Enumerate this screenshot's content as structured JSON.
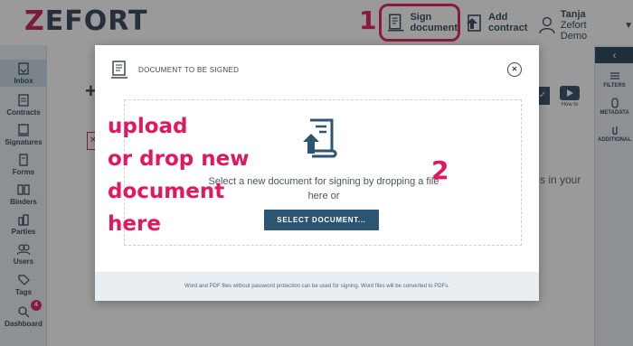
{
  "header": {
    "logo_z": "Z",
    "logo_rest": "EFORT",
    "sign_document_line1": "Sign",
    "sign_document_line2": "document",
    "add_contract_line1": "Add",
    "add_contract_line2": "contract",
    "user_name": "Tanja",
    "user_org": "Zefort Demo"
  },
  "annotations": {
    "step1": "1",
    "step2": "2",
    "upload_line1": "upload",
    "upload_line2": "or drop new",
    "upload_line3": "document",
    "upload_line4": "here"
  },
  "sidebar": {
    "items": [
      {
        "label": "Inbox",
        "icon": "inbox-icon"
      },
      {
        "label": "Contracts",
        "icon": "contracts-icon"
      },
      {
        "label": "Signatures",
        "icon": "signatures-icon"
      },
      {
        "label": "Forms",
        "icon": "forms-icon"
      },
      {
        "label": "Binders",
        "icon": "binders-icon"
      },
      {
        "label": "Parties",
        "icon": "parties-icon"
      },
      {
        "label": "Users",
        "icon": "users-icon"
      },
      {
        "label": "Tags",
        "icon": "tags-icon"
      },
      {
        "label": "Dashboard",
        "icon": "dashboard-icon"
      }
    ],
    "dashboard_badge": "4"
  },
  "right_sidebar": {
    "collapse": "‹",
    "items": [
      {
        "label": "FILTERS"
      },
      {
        "label": "METADATA"
      },
      {
        "label": "ADDITIONAL"
      }
    ]
  },
  "main": {
    "plus": "+",
    "x_mark": "✕",
    "check": "✓",
    "how_to": "How to",
    "partial_text": "s in your"
  },
  "modal": {
    "title": "DOCUMENT TO BE SIGNED",
    "close": "✕",
    "drop_text": "Select a new document for signing by dropping a file here or",
    "select_button": "SELECT DOCUMENT...",
    "footer": "Word and PDF files without password protection can be used for signing. Word files will be converted to PDFs."
  },
  "colors": {
    "accent": "#e2175f",
    "primary": "#2c5473",
    "dark": "#2d4356"
  }
}
